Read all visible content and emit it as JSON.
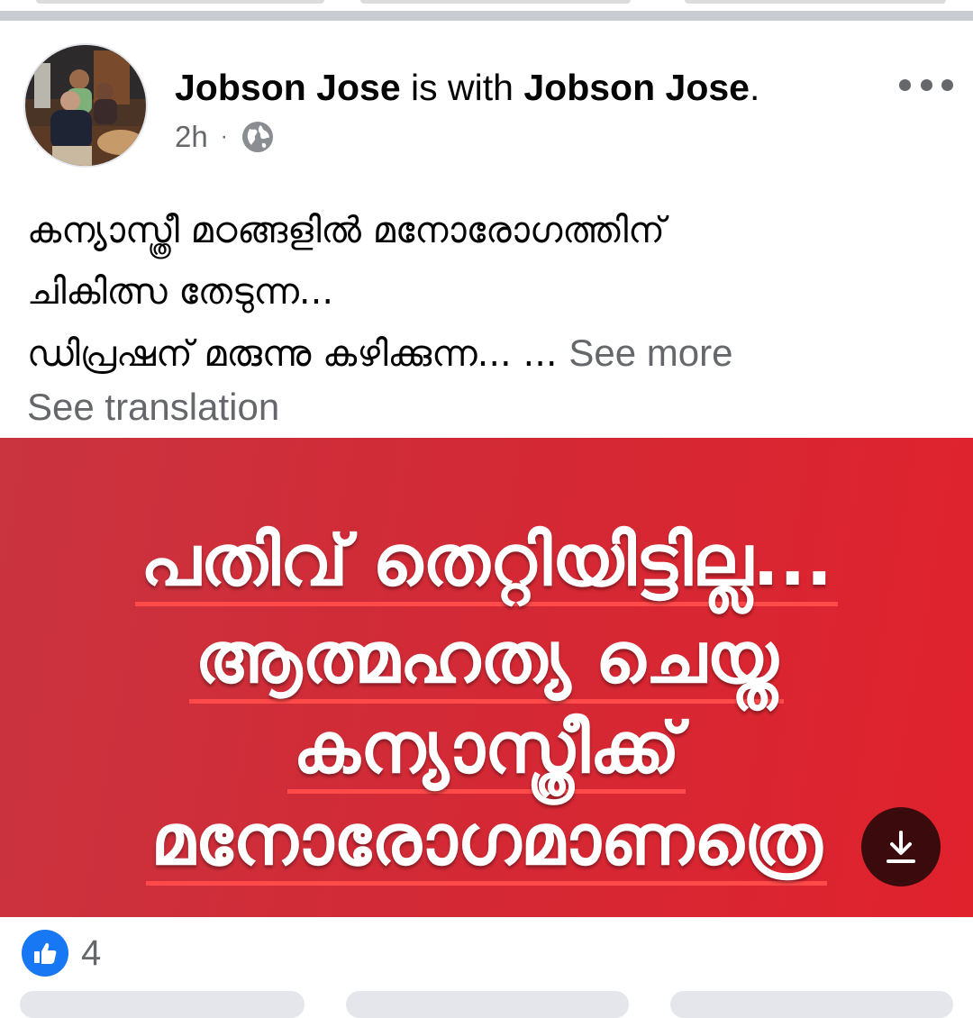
{
  "post": {
    "author_name": "Jobson Jose",
    "with_text": "is with",
    "tagged_name": "Jobson Jose",
    "time": "2h",
    "separator": "·",
    "privacy_icon": "globe-icon",
    "menu_icon": "more-options-icon"
  },
  "text": {
    "line1": "കന്യാസ്ത്രീ മഠങ്ങളിൽ മനോരോഗത്തിന്",
    "line2": "ചികിത്സ തേടുന്ന...",
    "line3": "ഡിപ്രഷന് മരുന്നു കഴിക്കുന്ന... ...",
    "see_more": "See more",
    "see_translation": "See translation"
  },
  "image": {
    "line1": "പതിവ് തെറ്റിയിട്ടില്ല...",
    "line2": "ആത്മഹത്യ ചെയ്ത",
    "line3": "കന്യാസ്ത്രീക്ക്",
    "line4": "മനോരോഗമാണത്രെ",
    "download_icon": "download-icon",
    "background_color": "#d8262f"
  },
  "reactions": {
    "icon": "like-icon",
    "count": "4",
    "color": "#1877f2"
  }
}
